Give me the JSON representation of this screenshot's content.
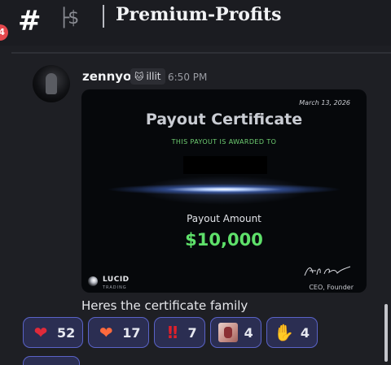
{
  "header": {
    "badge_count": "4",
    "channel_glyph": "├$",
    "channel_name": "Premium-Profits"
  },
  "message": {
    "username": "zennyo",
    "tag_label": "illit",
    "timestamp": "6:50 PM",
    "text": "Heres the certificate family"
  },
  "certificate": {
    "date": "March 13, 2026",
    "title": "Payout Certificate",
    "subtitle": "THIS PAYOUT IS AWARDED TO",
    "amount_label": "Payout Amount",
    "amount": "$10,000",
    "brand": "LUCID",
    "brand_sub": "TRADING",
    "role": "CEO, Founder"
  },
  "reactions": [
    {
      "icon": "red-heart",
      "count": "52"
    },
    {
      "icon": "heart-on-fire",
      "count": "17"
    },
    {
      "icon": "double-exclamation",
      "count": "7"
    },
    {
      "icon": "custom-image",
      "count": "4"
    },
    {
      "icon": "clapping-hands",
      "count": "4"
    }
  ],
  "colors": {
    "accent": "#5a63c8",
    "amount_green": "#5ee06a",
    "badge_red": "#e5484d",
    "background": "#1e1f24"
  }
}
